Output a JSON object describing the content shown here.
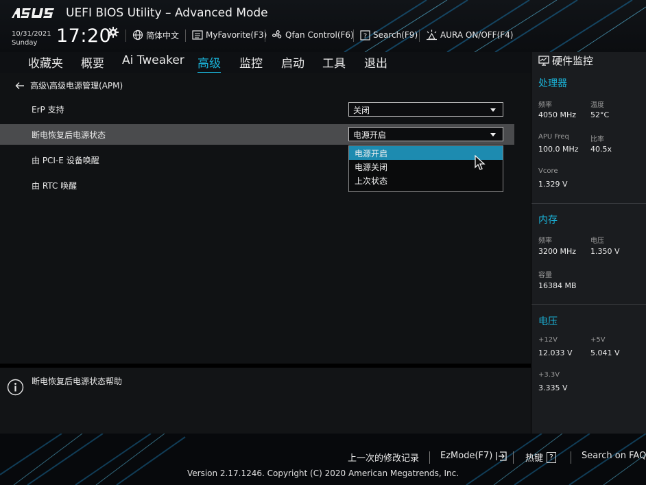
{
  "header": {
    "brand": "ASUS",
    "title": "UEFI BIOS Utility – Advanced Mode",
    "date": "10/31/2021",
    "day": "Sunday",
    "time": "17:20",
    "tools": {
      "language": "简体中文",
      "favorite": "MyFavorite(F3)",
      "qfan": "Qfan Control(F6)",
      "search": "Search(F9)",
      "aura": "AURA ON/OFF(F4)"
    }
  },
  "tabs": [
    "收藏夹",
    "概要",
    "Ai Tweaker",
    "高级",
    "监控",
    "启动",
    "工具",
    "退出"
  ],
  "active_tab": "高级",
  "breadcrumb": "高级\\高级电源管理(APM)",
  "settings": [
    {
      "label": "ErP 支持",
      "value": "关闭"
    },
    {
      "label": "断电恢复后电源状态",
      "value": "电源开启"
    },
    {
      "label": "由 PCI-E 设备唤醒",
      "value": ""
    },
    {
      "label": "由 RTC 唤醒",
      "value": ""
    }
  ],
  "dropdown": {
    "options": [
      "电源开启",
      "电源关闭",
      "上次状态"
    ],
    "selected": "电源开启"
  },
  "help": {
    "text": "断电恢复后电源状态帮助"
  },
  "monitor": {
    "title": "硬件监控",
    "cpu": {
      "title": "处理器",
      "freq_label": "频率",
      "freq": "4050 MHz",
      "temp_label": "温度",
      "temp": "52°C",
      "apu_label": "APU Freq",
      "apu": "100.0 MHz",
      "ratio_label": "比率",
      "ratio": "40.5x",
      "vcore_label": "Vcore",
      "vcore": "1.329 V"
    },
    "memory": {
      "title": "内存",
      "freq_label": "频率",
      "freq": "3200 MHz",
      "volt_label": "电压",
      "volt": "1.350 V",
      "cap_label": "容量",
      "cap": "16384 MB"
    },
    "voltage": {
      "title": "电压",
      "v12_label": "+12V",
      "v12": "12.033 V",
      "v5_label": "+5V",
      "v5": "5.041 V",
      "v33_label": "+3.3V",
      "v33": "3.335 V"
    }
  },
  "footer": {
    "last_changes": "上一次的修改记录",
    "ezmode": "EzMode(F7)",
    "hotkeys": "热键",
    "hotkeys_key": "?",
    "search_faq": "Search on FAQ",
    "copyright": "Version 2.17.1246. Copyright (C) 2020 American Megatrends, Inc."
  },
  "colors": {
    "accent": "#1ab3d8",
    "selected_option": "#1d8bb0",
    "highlight_row": "#4a4b4d"
  }
}
